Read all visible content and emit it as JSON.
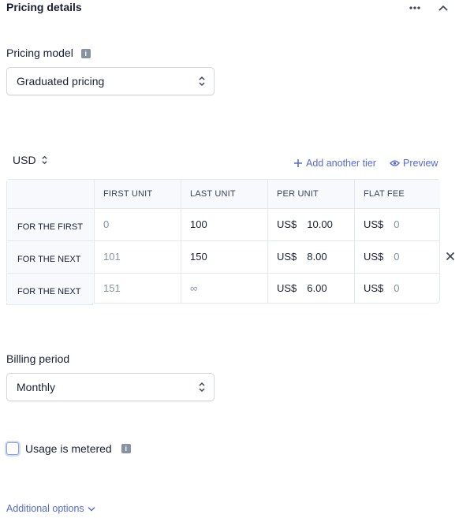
{
  "section": {
    "title": "Pricing details"
  },
  "pricing_model": {
    "label": "Pricing model",
    "value": "Graduated pricing"
  },
  "currency": {
    "value": "USD"
  },
  "actions": {
    "add_tier": "Add another tier",
    "preview": "Preview"
  },
  "table": {
    "headers": [
      "FIRST UNIT",
      "LAST UNIT",
      "PER UNIT",
      "FLAT FEE"
    ],
    "rows": [
      {
        "label": "FOR THE FIRST",
        "first": "0",
        "last": "100",
        "per_prefix": "US$",
        "per": "10.00",
        "flat_prefix": "US$",
        "flat": "0"
      },
      {
        "label": "FOR THE NEXT",
        "first": "101",
        "last": "150",
        "per_prefix": "US$",
        "per": "8.00",
        "flat_prefix": "US$",
        "flat": "0"
      },
      {
        "label": "FOR THE NEXT",
        "first": "151",
        "last": "∞",
        "per_prefix": "US$",
        "per": "6.00",
        "flat_prefix": "US$",
        "flat": "0"
      }
    ]
  },
  "billing_period": {
    "label": "Billing period",
    "value": "Monthly"
  },
  "metered": {
    "label": "Usage is metered",
    "checked": false
  },
  "additional_options": {
    "label": "Additional options"
  },
  "colors": {
    "accent": "#5469d4",
    "border": "#e3e8ee",
    "muted": "#8792a2",
    "text": "#1a1f36"
  },
  "icons": [
    "more-icon",
    "chevron-up-icon",
    "info-icon",
    "select-chevron-icon",
    "plus-icon",
    "eye-icon",
    "close-icon",
    "chevron-down-icon"
  ]
}
